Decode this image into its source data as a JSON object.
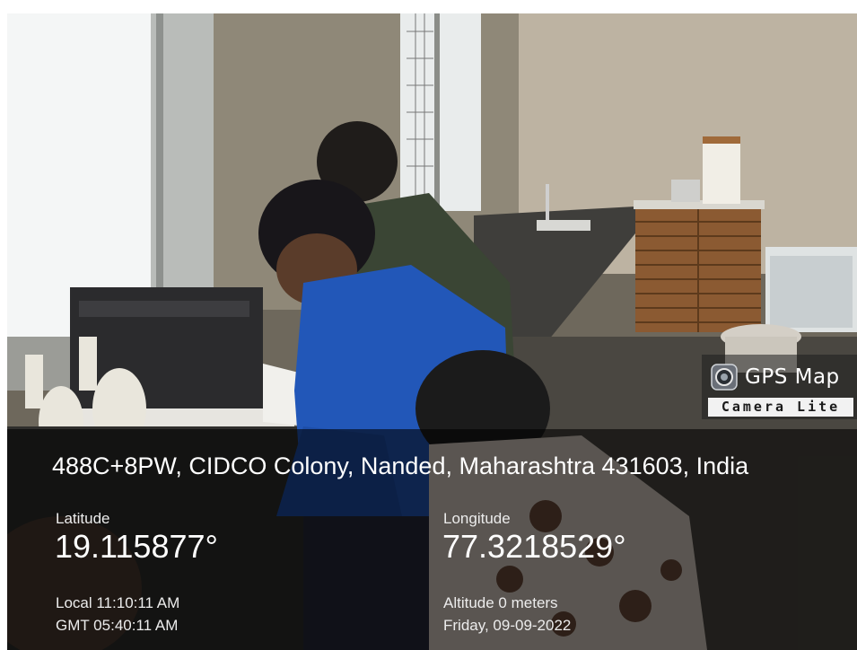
{
  "watermark": {
    "app_name": "GPS Map",
    "app_subtitle": "Camera Lite",
    "icon": "camera-lens-icon"
  },
  "location": {
    "address": "488C+8PW, CIDCO Colony, Nanded, Maharashtra 431603, India",
    "latitude_label": "Latitude",
    "latitude_value": "19.115877°",
    "longitude_label": "Longitude",
    "longitude_value": "77.3218529°",
    "local_time": "Local 11:10:11 AM",
    "gmt_time": "GMT 05:40:11 AM",
    "altitude": "Altitude 0 meters",
    "date": "Friday, 09-09-2022"
  }
}
